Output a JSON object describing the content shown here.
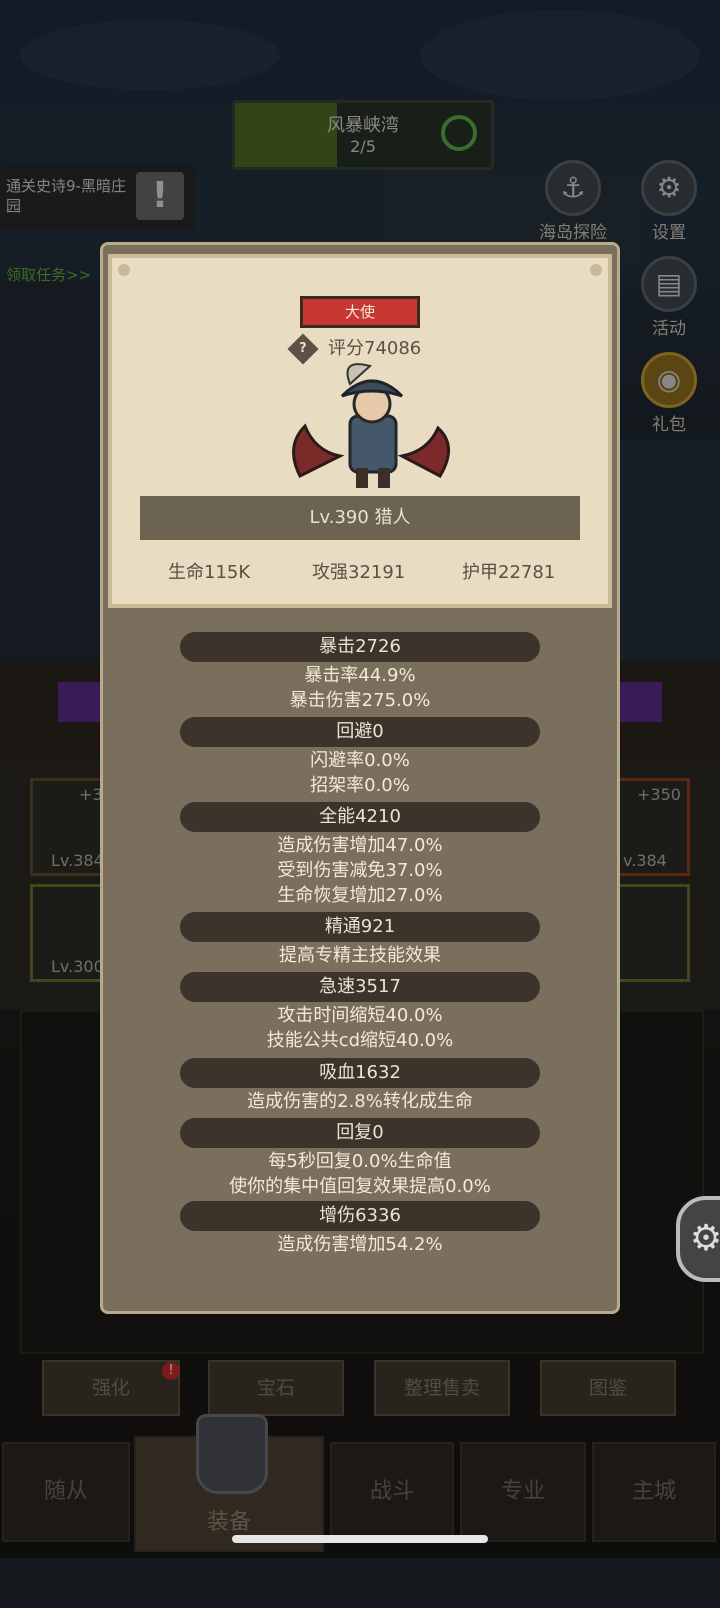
{
  "stage": {
    "name": "风暴峡湾",
    "progress_text": "2/5",
    "progress_fraction": 0.4
  },
  "quest": {
    "text": "通关史诗9-黑暗庄园",
    "warn_icon": "exclamation-icon",
    "claim": "领取任务>>"
  },
  "right_menu": {
    "island": {
      "label": "海岛探险",
      "icon": "anchor-icon"
    },
    "settings": {
      "label": "设置",
      "icon": "gear-icon"
    },
    "events": {
      "label": "活动",
      "icon": "calendar-icon"
    },
    "gift": {
      "label": "礼包",
      "icon": "giftbag-icon"
    }
  },
  "equipment_side": {
    "left_top": {
      "plus": "+3",
      "level": "Lv.384"
    },
    "left_bottom": {
      "level": "Lv.300"
    },
    "right_top": {
      "plus": "+350",
      "level": "v.384"
    }
  },
  "character": {
    "title": "大使",
    "score": "评分74086",
    "name": "Lv.390 猎人",
    "hp": "生命115K",
    "attack": "攻强32191",
    "armor": "护甲22781"
  },
  "stats": {
    "crit": {
      "header": "暴击2726",
      "lines": [
        "暴击率44.9%",
        "暴击伤害275.0%"
      ]
    },
    "dodge": {
      "header": "回避0",
      "lines": [
        "闪避率0.0%",
        "招架率0.0%"
      ]
    },
    "versatility": {
      "header": "全能4210",
      "lines": [
        "造成伤害增加47.0%",
        "受到伤害减免37.0%",
        "生命恢复增加27.0%"
      ]
    },
    "mastery": {
      "header": "精通921",
      "lines": [
        "提高专精主技能效果"
      ]
    },
    "haste": {
      "header": "急速3517",
      "lines": [
        "攻击时间缩短40.0%",
        "技能公共cd缩短40.0%"
      ]
    },
    "leech": {
      "header": "吸血1632",
      "lines": [
        "造成伤害的2.8%转化成生命"
      ]
    },
    "regen": {
      "header": "回复0",
      "lines": [
        "每5秒回复0.0%生命值",
        "使你的集中值回复效果提高0.0%"
      ]
    },
    "damage_boost": {
      "header": "增伤6336",
      "lines": [
        "造成伤害增加54.2%"
      ]
    }
  },
  "function_buttons": [
    "强化",
    "宝石",
    "整理售卖",
    "图鉴"
  ],
  "bottom_nav": [
    "随从",
    "装备",
    "战斗",
    "专业",
    "主城"
  ],
  "colors": {
    "title_badge": "#c83832",
    "stat_bar": "#3c342b",
    "panel": "#7a6e5c",
    "card": "#e8dcc3",
    "accent_green": "#62a23c"
  }
}
